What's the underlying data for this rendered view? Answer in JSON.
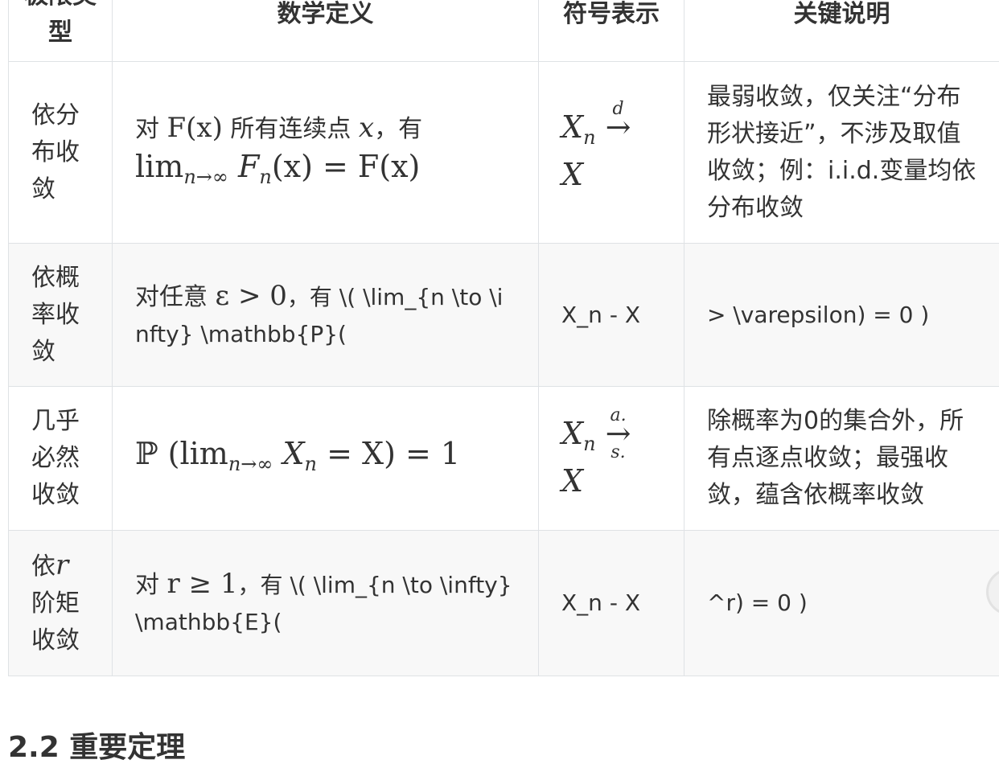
{
  "table": {
    "headers": [
      "极限类型",
      "数学定义",
      "符号表示",
      "关键说明"
    ],
    "rows": [
      {
        "type": "依分布收敛",
        "def_pre": "对 ",
        "def_math1": "F(x)",
        "def_mid": " 所有连续点 ",
        "def_math2": "x",
        "def_post": "，有",
        "def_line2": "lim",
        "def_line2_sub": "n→∞",
        "def_line2_rest": "F",
        "def_line2_sub2": "n",
        "def_line2_tail": "(x) = F(x)",
        "sym_var": "X",
        "sym_sub": "n",
        "sym_label": "d",
        "sym_arrow": "→",
        "sym_target": "X",
        "note": "最弱收敛，仅关注“分布形状接近”，不涉及取值收敛；例：i.i.d.变量均依分布收敛"
      },
      {
        "type": "依概率收敛",
        "def_pre": "对任意 ",
        "def_math": "ε > 0",
        "def_post": "，有 \\( \\lim_{n \\to \\infty} \\mathbb{P}(",
        "sym": "X_n - X",
        "note": "> \\varepsilon) = 0 )"
      },
      {
        "type": "几乎必然收敛",
        "def_p": "ℙ",
        "def_lim": "(lim",
        "def_sub": "n→∞",
        "def_var": " X",
        "def_var_sub": "n",
        "def_tail": " = X) = 1",
        "sym_var": "X",
        "sym_sub": "n",
        "sym_label": "a.s.",
        "sym_arrow": "→",
        "sym_target": "X",
        "note": "除概率为0的集合外，所有点逐点收敛；最强收敛，蕴含依概率收敛"
      },
      {
        "type_pre": "依",
        "type_math": "r",
        "type_post": "阶矩收敛",
        "def_pre": "对 ",
        "def_math": "r ≥ 1",
        "def_post": "，有 \\( \\lim_{n \\to \\infty} \\mathbb{E}(",
        "sym": "X_n - X",
        "note": "^r) = 0 )"
      }
    ]
  },
  "section_heading": "2.2 重要定理"
}
